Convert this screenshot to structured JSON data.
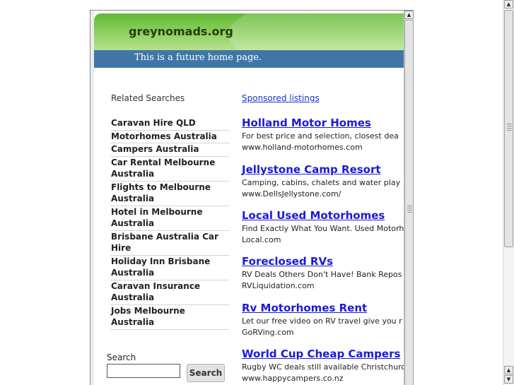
{
  "site": {
    "title": "greynomads.org",
    "tagline": "This is a future home page."
  },
  "related": {
    "heading": "Related Searches",
    "items": [
      "Caravan Hire QLD",
      "Motorhomes Australia",
      "Campers Australia",
      "Car Rental Melbourne Australia",
      "Flights to Melbourne Australia",
      "Hotel in Melbourne Australia",
      "Brisbane Australia Car Hire",
      "Holiday Inn Brisbane Australia",
      "Caravan Insurance Australia",
      "Jobs Melbourne Australia"
    ]
  },
  "search": {
    "label": "Search",
    "button": "Search",
    "value": ""
  },
  "sponsored": {
    "heading": "Sponsored listings",
    "ads": [
      {
        "title": "Holland Motor Homes",
        "desc": "For best price and selection, closest dea",
        "url": "www.holland-motorhomes.com"
      },
      {
        "title": "Jellystone Camp Resort",
        "desc": "Camping, cabins, chalets and water play",
        "url": "www.DellsJellystone.com/"
      },
      {
        "title": "Local Used Motorhomes",
        "desc": "Find Exactly What You Want. Used Motorh",
        "url": "Local.com"
      },
      {
        "title": "Foreclosed RVs",
        "desc": "RV Deals Others Don't Have! Bank Repos",
        "url": "RVLiquidation.com"
      },
      {
        "title": "Rv Motorhomes Rent",
        "desc": "Let our free video on RV travel give you r",
        "url": "GoRVing.com"
      },
      {
        "title": "World Cup Cheap Campers",
        "desc": "Rugby WC deals still available Christchurc",
        "url": "www.happycampers.co.nz"
      }
    ]
  },
  "icons": {
    "scroll_up": "scroll-up-arrow-icon",
    "scroll_down": "scroll-down-arrow-icon",
    "grip": "scrollbar-grip-icon"
  },
  "colors": {
    "banner_green": "#78c447",
    "tagline_bar": "#3f76a6",
    "link_blue": "#1a1adb"
  }
}
